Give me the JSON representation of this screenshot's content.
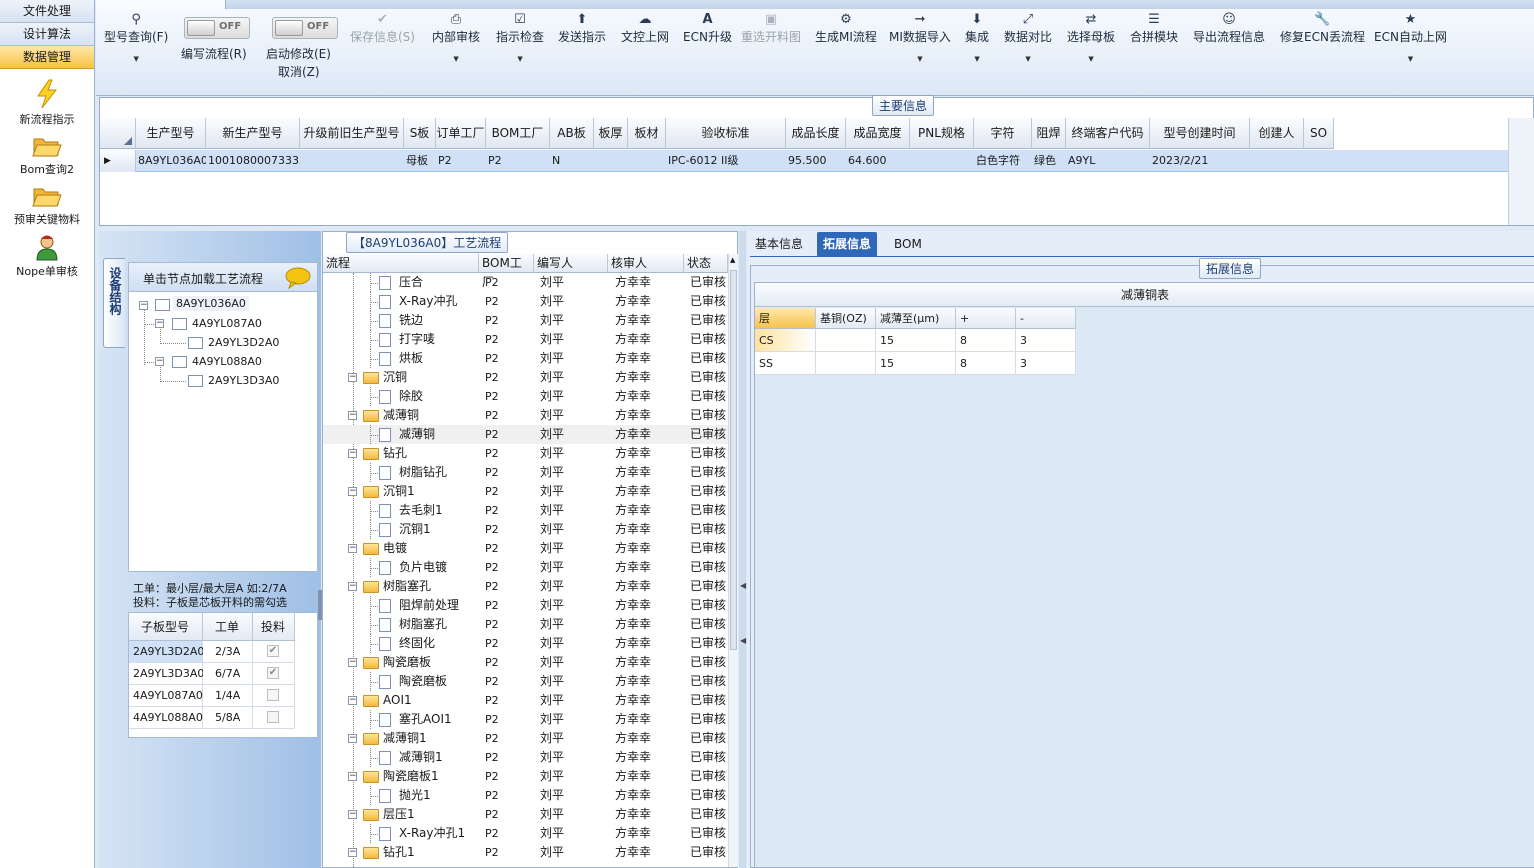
{
  "sidebar": {
    "buttons": [
      "文件处理",
      "设计算法",
      "数据管理"
    ],
    "tools": [
      {
        "label": "新流程指示",
        "icon": "lightning-icon"
      },
      {
        "label": "Bom查询2",
        "icon": "folder-open-icon"
      },
      {
        "label": "预审关键物料",
        "icon": "folder-open-icon"
      },
      {
        "label": "Nope单审核",
        "icon": "user-icon"
      }
    ]
  },
  "toolbar": {
    "items": [
      {
        "label": "型号查询(F)",
        "icon": "search-icon"
      },
      {
        "label": "编写流程(R)",
        "toggle": "OFF"
      },
      {
        "label": "启动修改(E)",
        "label2": "取消(Z)",
        "toggle": "OFF"
      },
      {
        "label": "保存信息(S)",
        "icon": "check-icon"
      },
      {
        "label": "内部审核",
        "icon": "printer-icon"
      },
      {
        "label": "指示检查",
        "icon": "checkbox-icon"
      },
      {
        "label": "发送指示",
        "icon": "upload-icon"
      },
      {
        "label": "文控上网",
        "icon": "cloud-upload-icon"
      },
      {
        "label": "ECN升级",
        "icon": "font-a-icon"
      },
      {
        "label": "重选开料图",
        "icon": "picture-icon"
      },
      {
        "label": "生成MI流程",
        "icon": "gears-icon"
      },
      {
        "label": "MI数据导入",
        "icon": "login-icon"
      },
      {
        "label": "集成",
        "icon": "download-icon"
      },
      {
        "label": "数据对比",
        "icon": "compress-icon"
      },
      {
        "label": "选择母板",
        "icon": "random-icon"
      },
      {
        "label": "合拼模块",
        "icon": "list-icon"
      },
      {
        "label": "导出流程信息",
        "icon": "smile-icon"
      },
      {
        "label": "修复ECN丢流程",
        "icon": "wrench-icon"
      },
      {
        "label": "ECN自动上网",
        "icon": "star-icon"
      }
    ]
  },
  "main_info": {
    "title": "主要信息",
    "columns": [
      "生产型号",
      "新生产型号",
      "升级前旧生产型号",
      "S板",
      "订单工厂",
      "BOM工厂",
      "AB板",
      "板厚",
      "板材",
      "验收标准",
      "成品长度",
      "成品宽度",
      "PNL规格",
      "字符",
      "阻焊",
      "终端客户代码",
      "型号创建时间",
      "创建人",
      "SO"
    ],
    "row": [
      "8A9YL036A0",
      "10010800073333",
      "",
      "母板",
      "P2",
      "P2",
      "N",
      "",
      "",
      "IPC-6012 II级",
      "95.500",
      "64.600",
      "",
      "白色字符",
      "绿色",
      "A9YL",
      "2023/2/21",
      "",
      ""
    ]
  },
  "left_panel": {
    "vtab": "设备结构",
    "hint": "单击节点加载工艺流程",
    "tree": [
      {
        "label": "8A9YL036A0",
        "level": 0
      },
      {
        "label": "4A9YL087A0",
        "level": 1
      },
      {
        "label": "2A9YL3D2A0",
        "level": 2
      },
      {
        "label": "4A9YL088A0",
        "level": 1
      },
      {
        "label": "2A9YL3D3A0",
        "level": 2
      }
    ],
    "note1": "工单：最小层/最大层A 如:2/7A",
    "note2": "投料：子板是芯板开料的需勾选",
    "sub_columns": [
      "子板型号",
      "工单",
      "投料"
    ],
    "sub_rows": [
      {
        "model": "2A9YL3D2A0",
        "order": "2/3A",
        "checked": true
      },
      {
        "model": "2A9YL3D3A0",
        "order": "6/7A",
        "checked": true
      },
      {
        "model": "4A9YL087A0",
        "order": "1/4A",
        "checked": false
      },
      {
        "model": "4A9YL088A0",
        "order": "5/8A",
        "checked": false
      }
    ]
  },
  "flow": {
    "title": "【8A9YL036A0】工艺流程",
    "columns": [
      "流程",
      "BOM工厂",
      "编写人",
      "核审人",
      "状态"
    ],
    "rows": [
      {
        "name": "压合",
        "type": "doc"
      },
      {
        "name": "X-Ray冲孔",
        "type": "doc"
      },
      {
        "name": "铣边",
        "type": "doc"
      },
      {
        "name": "打字唛",
        "type": "doc"
      },
      {
        "name": "烘板",
        "type": "doc"
      },
      {
        "name": "沉铜",
        "type": "folder"
      },
      {
        "name": "除胶",
        "type": "doc"
      },
      {
        "name": "减薄铜",
        "type": "folder"
      },
      {
        "name": "减薄铜",
        "type": "doc"
      },
      {
        "name": "钻孔",
        "type": "folder"
      },
      {
        "name": "树脂钻孔",
        "type": "doc"
      },
      {
        "name": "沉铜1",
        "type": "folder"
      },
      {
        "name": "去毛刺1",
        "type": "doc"
      },
      {
        "name": "沉铜1",
        "type": "doc"
      },
      {
        "name": "电镀",
        "type": "folder"
      },
      {
        "name": "负片电镀",
        "type": "doc"
      },
      {
        "name": "树脂塞孔",
        "type": "folder"
      },
      {
        "name": "阻焊前处理",
        "type": "doc"
      },
      {
        "name": "树脂塞孔",
        "type": "doc"
      },
      {
        "name": "终固化",
        "type": "doc"
      },
      {
        "name": "陶瓷磨板",
        "type": "folder"
      },
      {
        "name": "陶瓷磨板",
        "type": "doc"
      },
      {
        "name": "AOI1",
        "type": "folder"
      },
      {
        "name": "塞孔AOI1",
        "type": "doc"
      },
      {
        "name": "减薄铜1",
        "type": "folder"
      },
      {
        "name": "减薄铜1",
        "type": "doc"
      },
      {
        "name": "陶瓷磨板1",
        "type": "folder"
      },
      {
        "name": "抛光1",
        "type": "doc"
      },
      {
        "name": "层压1",
        "type": "folder"
      },
      {
        "name": "X-Ray冲孔1",
        "type": "doc"
      },
      {
        "name": "钻孔1",
        "type": "folder"
      }
    ],
    "bom": "P2",
    "writer": "刘平",
    "reviewer": "方幸幸",
    "status": "已审核"
  },
  "right_panel": {
    "tabs": [
      "基本信息",
      "拓展信息",
      "BOM"
    ],
    "group_title": "拓展信息",
    "table_title": "减薄铜表",
    "columns": [
      "层",
      "基铜(OZ)",
      "减薄至(μm)",
      "+",
      "-"
    ],
    "rows": [
      [
        "CS",
        "",
        "15",
        "8",
        "3"
      ],
      [
        "SS",
        "",
        "15",
        "8",
        "3"
      ]
    ]
  },
  "colors": {
    "active_tab": "#2f68b8",
    "selected_row": "#cfe0f7",
    "highlight": "#f6c24a"
  }
}
